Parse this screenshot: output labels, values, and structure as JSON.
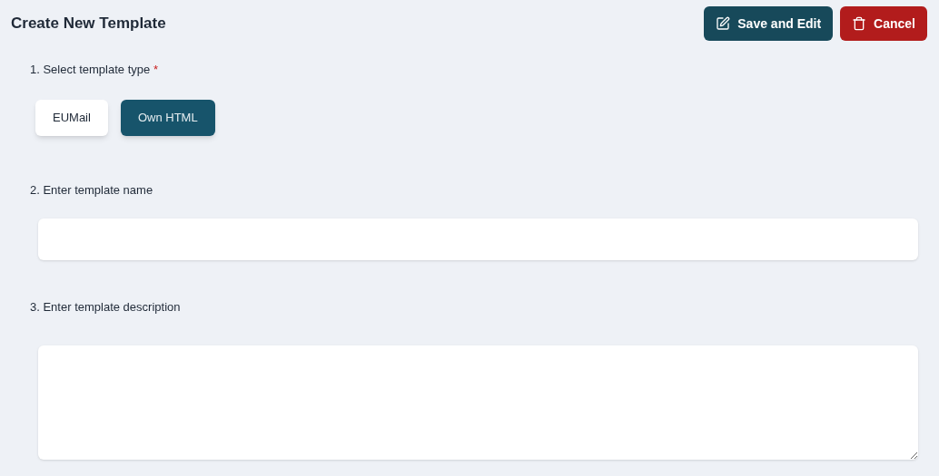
{
  "title": "Create New Template",
  "actions": [
    {
      "kind": "edit",
      "label": "Save and Edit"
    },
    {
      "kind": "delete",
      "label": "Cancel"
    }
  ],
  "type_step": {
    "label": "1. Select template type",
    "required_mark": "*",
    "options": [
      {
        "label": "EUMail",
        "selected": false
      },
      {
        "label": "Own HTML",
        "selected": true
      }
    ]
  },
  "name_step": {
    "label": "2. Enter template name"
  },
  "description_step": {
    "label": "3. Enter template description"
  }
}
